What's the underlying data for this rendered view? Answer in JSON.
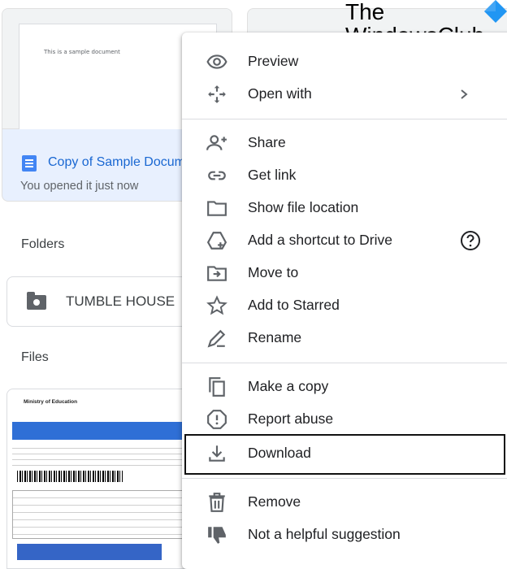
{
  "recent_file": {
    "thumbnail_text": "This is a sample document",
    "title": "Copy of Sample Docum",
    "subtitle": "You opened it just now"
  },
  "sections": {
    "folders": "Folders",
    "files": "Files"
  },
  "folder": {
    "name": "TUMBLE HOUSE"
  },
  "file_thumbnail": {
    "header": "Ministry of Education"
  },
  "watermark": {
    "line1": "The",
    "line2": "WindowsClub"
  },
  "context_menu": {
    "items": [
      {
        "label": "Preview",
        "icon": "eye-icon"
      },
      {
        "label": "Open with",
        "icon": "open-with-icon"
      },
      {
        "label": "Share",
        "icon": "person-add-icon"
      },
      {
        "label": "Get link",
        "icon": "link-icon"
      },
      {
        "label": "Show file location",
        "icon": "folder-icon"
      },
      {
        "label": "Add a shortcut to Drive",
        "icon": "drive-shortcut-icon"
      },
      {
        "label": "Move to",
        "icon": "move-to-folder-icon"
      },
      {
        "label": "Add to Starred",
        "icon": "star-icon"
      },
      {
        "label": "Rename",
        "icon": "pencil-icon"
      },
      {
        "label": "Make a copy",
        "icon": "copy-icon"
      },
      {
        "label": "Report abuse",
        "icon": "report-icon"
      },
      {
        "label": "Download",
        "icon": "download-icon"
      },
      {
        "label": "Remove",
        "icon": "trash-icon"
      },
      {
        "label": "Not a helpful suggestion",
        "icon": "thumbs-down-icon"
      }
    ]
  },
  "colors": {
    "accent": "#1967d2",
    "icon": "#5f6368",
    "highlight_border": "#111111"
  }
}
